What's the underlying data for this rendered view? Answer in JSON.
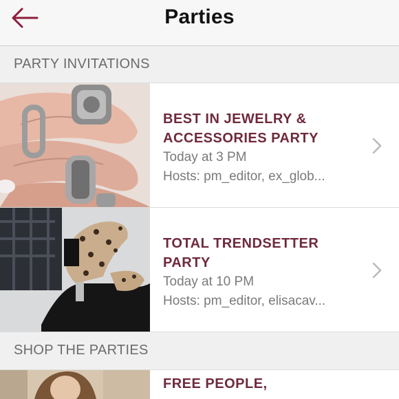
{
  "header": {
    "title": "Parties",
    "back_icon": "arrow-left-icon",
    "accent_color": "#8c1d3b"
  },
  "sections": {
    "invitations": "PARTY INVITATIONS",
    "shop": "SHOP THE PARTIES"
  },
  "parties": [
    {
      "title": "BEST IN JEWELRY &\nACCESSORIES PARTY",
      "time": "Today at 3 PM",
      "hosts": "Hosts: pm_editor, ex_glob...",
      "image": "silver-rings-on-hand"
    },
    {
      "title": "TOTAL TRENDSETTER\nPARTY",
      "time": "Today at 10 PM",
      "hosts": "Hosts: pm_editor, elisacav...",
      "image": "leopard-print-booties"
    }
  ],
  "shop_parties": [
    {
      "title": "FREE PEOPLE,",
      "image": "woman-portrait"
    }
  ],
  "colors": {
    "party_title": "#6e2a3c",
    "subtext": "#7a7a7a",
    "section_bg": "#f1f0f0"
  }
}
